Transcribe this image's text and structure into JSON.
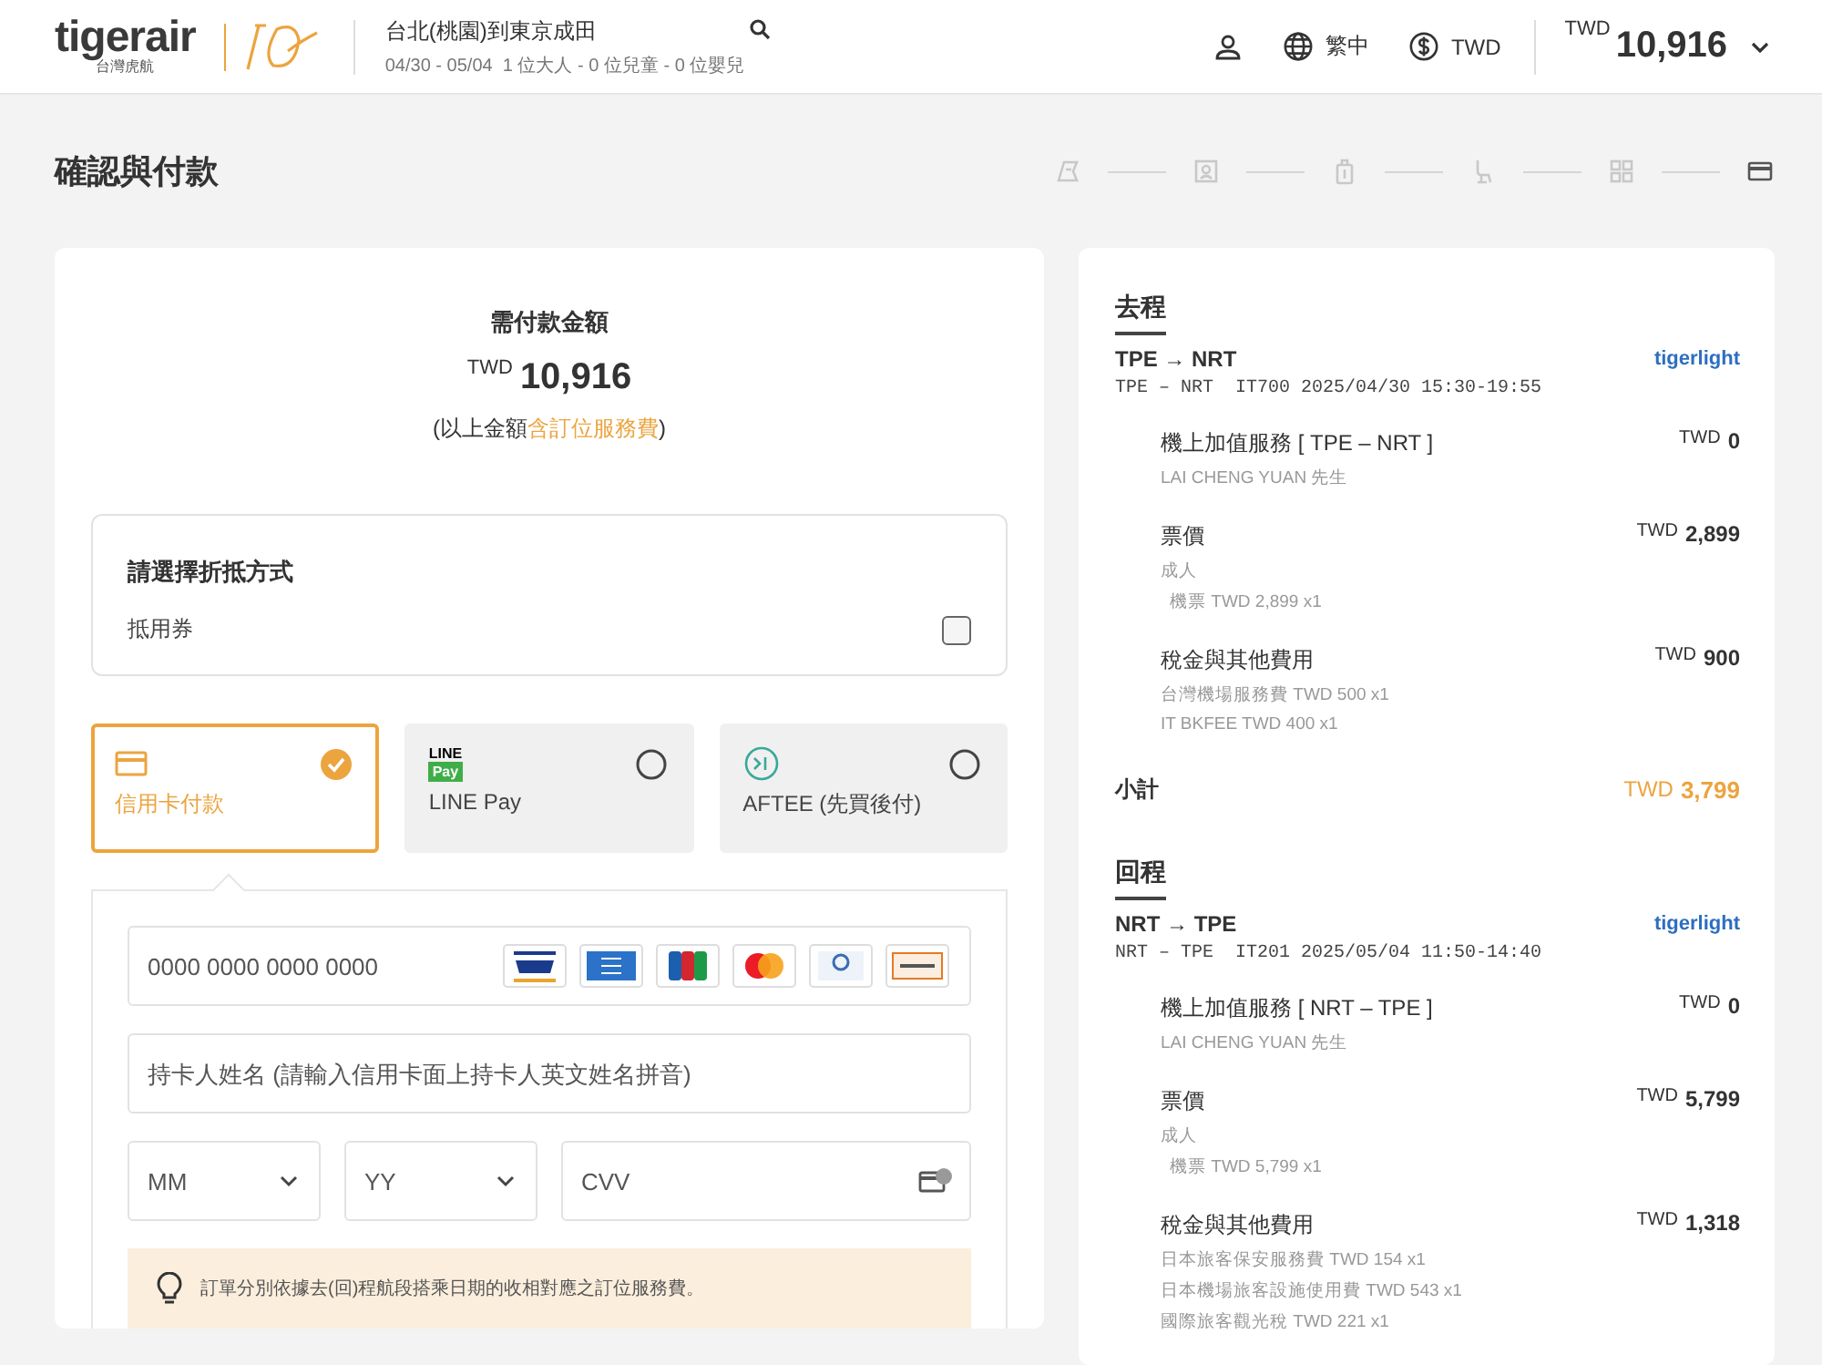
{
  "header": {
    "brand": "tigerair",
    "brand_sub": "台灣虎航",
    "trip_title": "台北(桃園)到東京成田",
    "trip_detail": "04/30 - 05/04  1 位大人 - 0 位兒童 - 0 位嬰兒",
    "language": "繁中",
    "currency": "TWD",
    "total_currency": "TWD",
    "total_amount": "10,916"
  },
  "page_title": "確認與付款",
  "steps": [
    {
      "selected": false
    },
    {
      "selected": false
    },
    {
      "selected": false
    },
    {
      "selected": false
    },
    {
      "selected": false
    },
    {
      "selected": true
    }
  ],
  "payment": {
    "heading": "需付款金額",
    "currency": "TWD",
    "amount": "10,916",
    "note_prefix": "(以上金額",
    "note_link": "含訂位服務費",
    "note_suffix": ")"
  },
  "discount": {
    "title": "請選擇折抵方式",
    "option_label": "抵用券",
    "checked": false
  },
  "methods": [
    {
      "kind": "card",
      "label": "信用卡付款",
      "selected": true
    },
    {
      "kind": "linepay",
      "label": "LINE Pay",
      "logo_top": "LINE",
      "logo_bottom": "Pay",
      "selected": false
    },
    {
      "kind": "aftee",
      "label": "AFTEE (先買後付)",
      "selected": false
    }
  ],
  "card_form": {
    "number_placeholder": "0000 0000 0000 0000",
    "name_placeholder": "持卡人姓名 (請輸入信用卡面上持卡人英文姓名拼音)",
    "month_placeholder": "MM",
    "year_placeholder": "YY",
    "cvv_placeholder": "CVV"
  },
  "notice": "訂單分別依據去(回)程航段搭乘日期的收相對應之訂位服務費。",
  "legs": [
    {
      "title": "去程",
      "route": "TPE → NRT",
      "fare_brand": "tigerlight",
      "flight": "TPE – NRT  IT700 2025/04/30 15:30-19:55",
      "items": [
        {
          "title": "機上加值服務 [ TPE – NRT ]",
          "currency": "TWD",
          "amount": "0",
          "details": [
            {
              "text": "LAI CHENG YUAN 先生",
              "indented": false
            }
          ]
        },
        {
          "title": "票價",
          "currency": "TWD",
          "amount": "2,899",
          "details": [
            {
              "text": "成人",
              "indented": false
            },
            {
              "text": "機票 TWD 2,899 x1",
              "indented": true
            }
          ]
        },
        {
          "title": "稅金與其他費用",
          "currency": "TWD",
          "amount": "900",
          "details": [
            {
              "text": "台灣機場服務費 TWD 500 x1",
              "indented": false
            },
            {
              "text": "IT BKFEE TWD 400 x1",
              "indented": false
            }
          ]
        }
      ],
      "subtotal": {
        "label": "小計",
        "currency": "TWD",
        "amount": "3,799"
      }
    },
    {
      "title": "回程",
      "route": "NRT → TPE",
      "fare_brand": "tigerlight",
      "flight": "NRT – TPE  IT201 2025/05/04 11:50-14:40",
      "items": [
        {
          "title": "機上加值服務 [ NRT – TPE ]",
          "currency": "TWD",
          "amount": "0",
          "details": [
            {
              "text": "LAI CHENG YUAN 先生",
              "indented": false
            }
          ]
        },
        {
          "title": "票價",
          "currency": "TWD",
          "amount": "5,799",
          "details": [
            {
              "text": "成人",
              "indented": false
            },
            {
              "text": "機票 TWD 5,799 x1",
              "indented": true
            }
          ]
        },
        {
          "title": "稅金與其他費用",
          "currency": "TWD",
          "amount": "1,318",
          "details": [
            {
              "text": "日本旅客保安服務費 TWD 154 x1",
              "indented": false
            },
            {
              "text": "日本機場旅客設施使用費 TWD 543 x1",
              "indented": false
            },
            {
              "text": "國際旅客觀光稅 TWD 221 x1",
              "indented": false
            }
          ]
        }
      ]
    }
  ]
}
